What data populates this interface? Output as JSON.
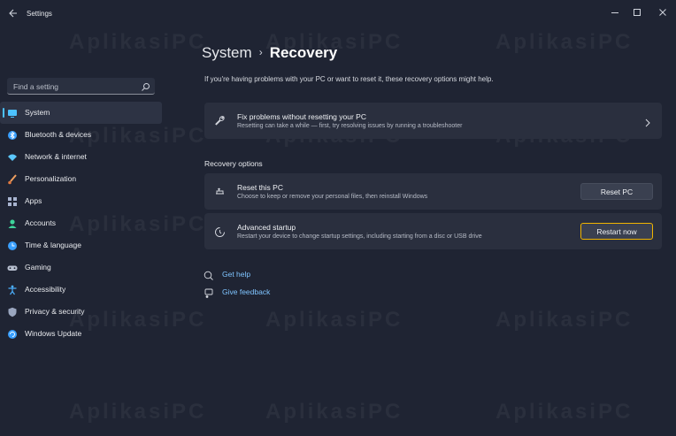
{
  "window": {
    "title": "Settings",
    "controls": [
      "minimize",
      "maximize",
      "close"
    ]
  },
  "search": {
    "placeholder": "Find a setting"
  },
  "sidebar": {
    "items": [
      {
        "label": "System",
        "icon": "monitor-icon",
        "active": true
      },
      {
        "label": "Bluetooth & devices",
        "icon": "bluetooth-icon"
      },
      {
        "label": "Network & internet",
        "icon": "wifi-icon"
      },
      {
        "label": "Personalization",
        "icon": "brush-icon"
      },
      {
        "label": "Apps",
        "icon": "apps-grid-icon"
      },
      {
        "label": "Accounts",
        "icon": "person-icon"
      },
      {
        "label": "Time & language",
        "icon": "globe-clock-icon"
      },
      {
        "label": "Gaming",
        "icon": "gamepad-icon"
      },
      {
        "label": "Accessibility",
        "icon": "accessibility-icon"
      },
      {
        "label": "Privacy & security",
        "icon": "shield-icon"
      },
      {
        "label": "Windows Update",
        "icon": "update-icon"
      }
    ]
  },
  "breadcrumb": {
    "parent": "System",
    "separator": "›",
    "current": "Recovery"
  },
  "intro": "If you're having problems with your PC or want to reset it, these recovery options might help.",
  "fix_card": {
    "title": "Fix problems without resetting your PC",
    "desc": "Resetting can take a while — first, try resolving issues by running a troubleshooter"
  },
  "recovery_options_label": "Recovery options",
  "reset_card": {
    "title": "Reset this PC",
    "desc": "Choose to keep or remove your personal files, then reinstall Windows",
    "button": "Reset PC"
  },
  "advanced_card": {
    "title": "Advanced startup",
    "desc": "Restart your device to change startup settings, including starting from a disc or USB drive",
    "button": "Restart now"
  },
  "links": {
    "help": "Get help",
    "feedback": "Give feedback"
  },
  "watermark": "AplikasiPC",
  "colors": {
    "accent": "#4cc2ff",
    "highlight": "#f0b400",
    "background": "#1f2433",
    "card": "#2a2f3e"
  }
}
